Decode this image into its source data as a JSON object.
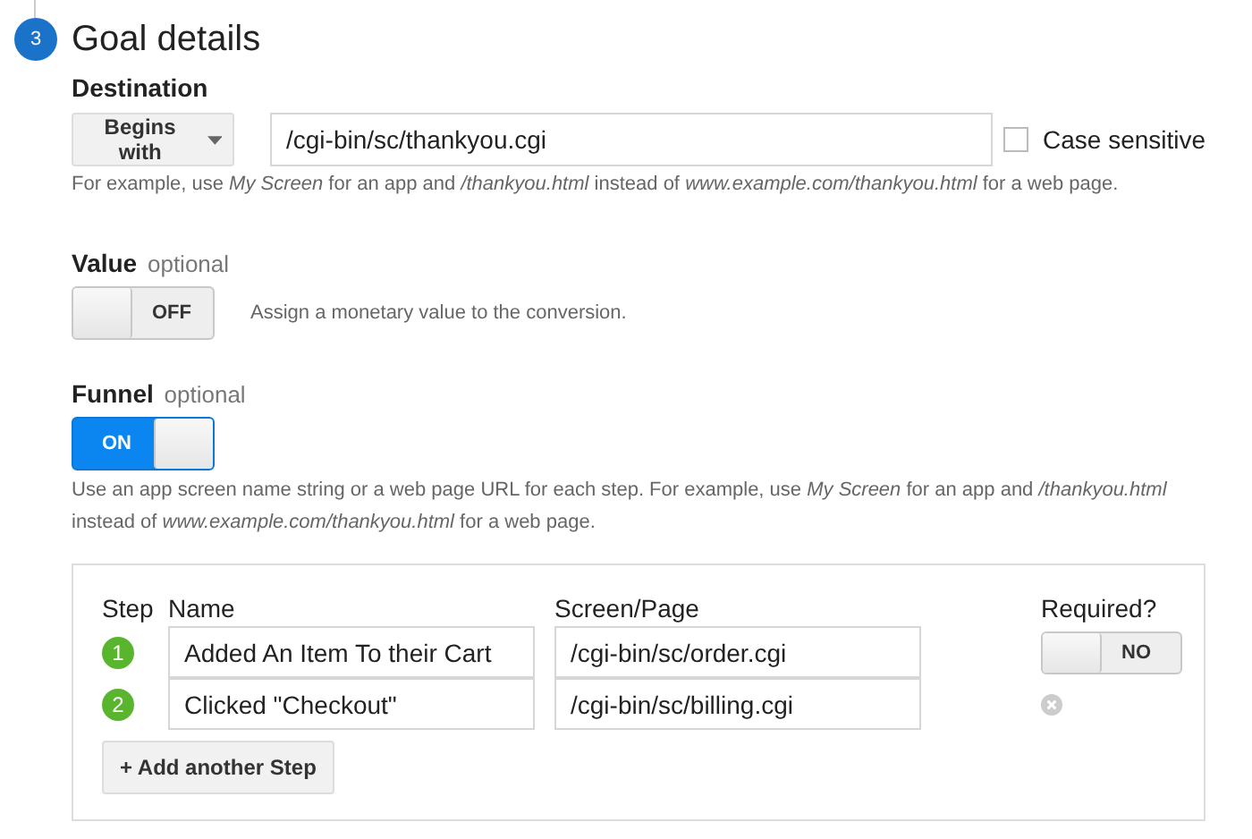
{
  "step_badge": "3",
  "title": "Goal details",
  "destination": {
    "label": "Destination",
    "match_type": "Begins with",
    "value": "/cgi-bin/sc/thankyou.cgi",
    "case_sensitive": {
      "label": "Case sensitive",
      "checked": false
    },
    "hint": "For example, use *My Screen* for an app and */thankyou.html* instead of *www.example.com/thankyou.html* for a web page."
  },
  "value": {
    "label": "Value",
    "optional": "optional",
    "toggle": {
      "on": false,
      "label": "OFF"
    },
    "hint": "Assign a monetary value to the conversion."
  },
  "funnel": {
    "label": "Funnel",
    "optional": "optional",
    "toggle": {
      "on": true,
      "label": "ON"
    },
    "hint": "Use an app screen name string or a web page URL for each step. For example, use *My Screen* for an app and */thankyou.html* instead of *www.example.com/thankyou.html* for a web page.",
    "columns": [
      "Step",
      "Name",
      "Screen/Page",
      "Required?"
    ],
    "steps": [
      {
        "number": "1",
        "name": "Added An Item To their Cart",
        "page": "/cgi-bin/sc/order.cgi",
        "kind": "required",
        "required": {
          "on": false,
          "label": "NO"
        }
      },
      {
        "number": "2",
        "name": "Clicked \"Checkout\"",
        "page": "/cgi-bin/sc/billing.cgi",
        "kind": "removable"
      }
    ],
    "add_button": "+ Add another Step"
  }
}
